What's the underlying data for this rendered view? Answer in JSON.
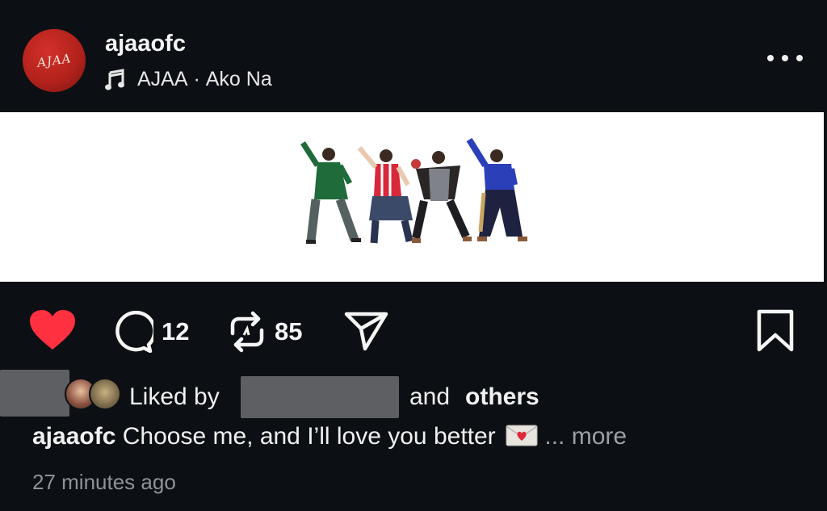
{
  "header": {
    "username": "ajaaofc",
    "avatar_text": "AJAA",
    "audio_artist": "AJAA",
    "audio_separator": " · ",
    "audio_title": "Ako Na"
  },
  "actions": {
    "comments_count": "12",
    "reposts_count": "85",
    "liked": true
  },
  "likes": {
    "prefix": "Liked by",
    "and": "and",
    "others": "others"
  },
  "caption": {
    "username": "ajaaofc",
    "text": "Choose me, and I’ll love you better",
    "ellipsis": "...",
    "more": "more"
  },
  "timestamp": "27 minutes ago",
  "colors": {
    "background": "#0c1014",
    "like_red": "#ff3040",
    "text_primary": "#f5f5f5",
    "text_secondary": "#8e9399"
  },
  "icons": [
    "music-note-icon",
    "more-options-icon",
    "heart-icon",
    "comment-icon",
    "repost-icon",
    "share-icon",
    "bookmark-icon",
    "love-letter-emoji"
  ]
}
